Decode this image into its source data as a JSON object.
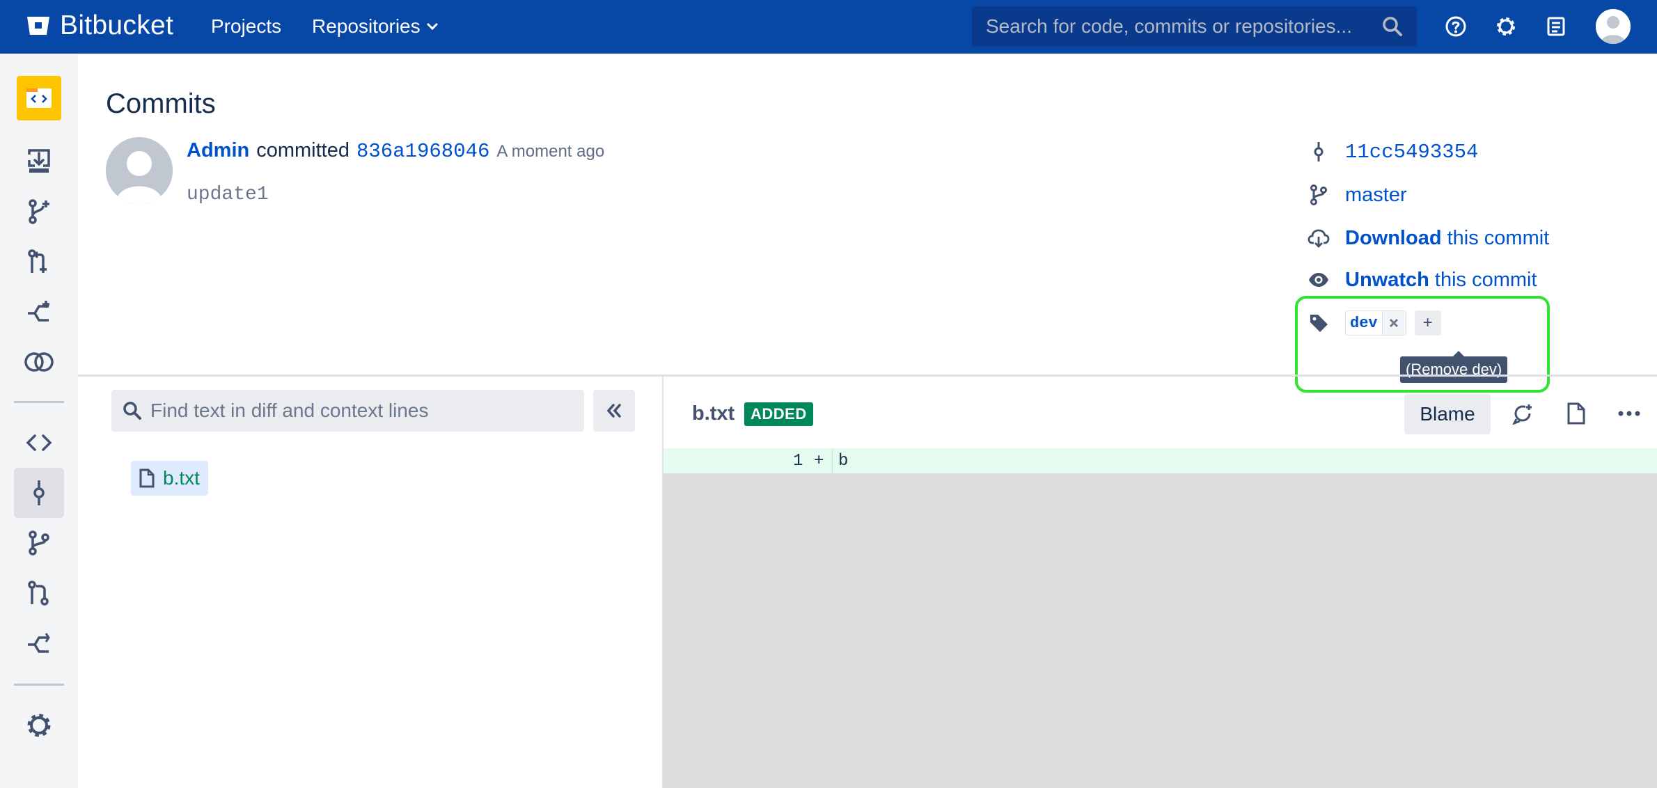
{
  "header": {
    "app_name": "Bitbucket",
    "nav": [
      {
        "label": "Projects"
      },
      {
        "label": "Repositories"
      }
    ],
    "search_placeholder": "Search for code, commits or repositories...",
    "icons": [
      "help-icon",
      "settings-icon",
      "notes-icon",
      "user-avatar"
    ],
    "brand_color": "#0747a6"
  },
  "sidebar": {
    "items": [
      {
        "name": "repository-avatar"
      },
      {
        "name": "clone-icon"
      },
      {
        "name": "create-branch-icon"
      },
      {
        "name": "create-pull-request-icon"
      },
      {
        "name": "fork-icon"
      },
      {
        "name": "compare-icon"
      },
      {
        "name": "source-icon"
      },
      {
        "name": "commits-icon",
        "active": true
      },
      {
        "name": "branches-icon"
      },
      {
        "name": "pull-requests-icon"
      },
      {
        "name": "forks-icon"
      },
      {
        "name": "repository-settings-icon"
      }
    ]
  },
  "commit": {
    "page_title": "Commits",
    "author": "Admin",
    "action": "committed",
    "hash": "836a1968046",
    "time": "A moment ago",
    "message": "update1"
  },
  "meta": {
    "parent_hash": "11cc5493354",
    "branch": "master",
    "download_bold": "Download",
    "download_rest": "this commit",
    "unwatch_bold": "Unwatch",
    "unwatch_rest": "this commit",
    "tag": "dev",
    "add_tag": "+",
    "tooltip": "(Remove dev)",
    "highlight_color": "#2ee52e"
  },
  "diff": {
    "search_placeholder": "Find text in diff and context lines",
    "tree_files": [
      "b.txt"
    ],
    "file_name": "b.txt",
    "status_badge": "ADDED",
    "blame_label": "Blame",
    "lines": [
      {
        "num": "1",
        "sign": "+",
        "code": "b"
      }
    ]
  }
}
